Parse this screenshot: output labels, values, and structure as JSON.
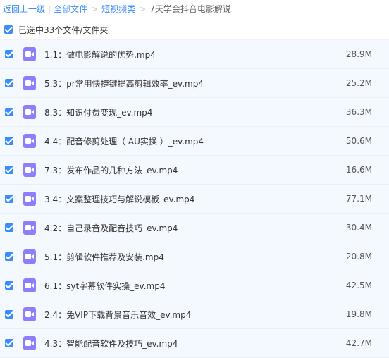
{
  "breadcrumb": {
    "back_label": "返回上一级",
    "items": [
      "全部文件",
      "短视频类"
    ],
    "current": "7天学会抖音电影解说"
  },
  "selection": {
    "label": "已选中33个文件/文件夹"
  },
  "files": [
    {
      "name": "1.1：做电影解说的优势.mp4",
      "size": "28.9M",
      "icon": "video-file-icon"
    },
    {
      "name": "5.3：pr常用快捷键提高剪辑效率_ev.mp4",
      "size": "25.2M",
      "icon": "video-file-icon"
    },
    {
      "name": "8.3：知识付费变现_ev.mp4",
      "size": "36.3M",
      "icon": "video-file-icon"
    },
    {
      "name": "4.4：配音修剪处理（ AU实操 ）_ev.mp4",
      "size": "50.6M",
      "icon": "video-file-icon"
    },
    {
      "name": "7.3：发布作品的几种方法_ev.mp4",
      "size": "16.6M",
      "icon": "video-file-icon"
    },
    {
      "name": "3.4：文案整理技巧与解说模板_ev.mp4",
      "size": "77.1M",
      "icon": "video-file-icon"
    },
    {
      "name": "4.2：自己录音及配音技巧_ev.mp4",
      "size": "30.4M",
      "icon": "video-file-icon"
    },
    {
      "name": "5.1：剪辑软件推荐及安装.mp4",
      "size": "20.8M",
      "icon": "video-file-icon"
    },
    {
      "name": "6.1：syt字幕软件实操_ev.mp4",
      "size": "42.5M",
      "icon": "video-file-icon"
    },
    {
      "name": "2.4：免VIP下载背景音乐音效_ev.mp4",
      "size": "19.8M",
      "icon": "video-file-icon"
    },
    {
      "name": "4.3：智能配音软件及技巧_ev.mp4",
      "size": "42.7M",
      "icon": "video-file-icon"
    }
  ],
  "colors": {
    "accent": "#3b8cff",
    "video_icon": "#8d7ffc",
    "row_selected_bg": "#f4f8ff"
  }
}
